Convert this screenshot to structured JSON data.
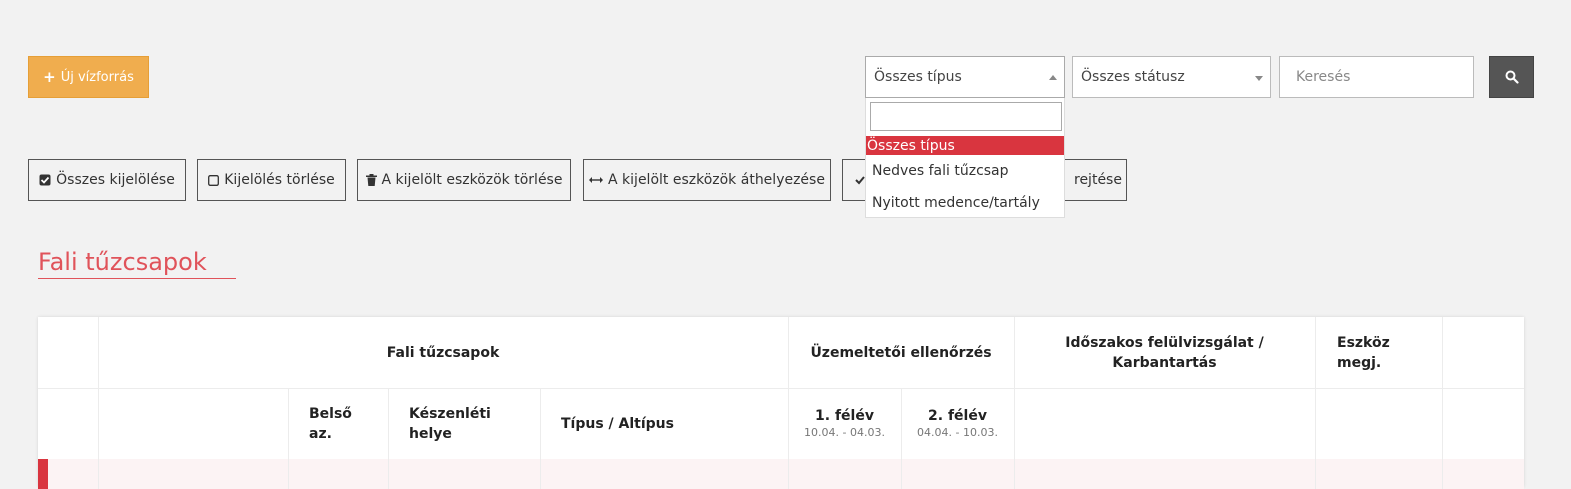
{
  "toolbar": {
    "new_label": "Új vízforrás",
    "type_filter": "Összes típus",
    "status_filter": "Összes státusz",
    "search_placeholder": "Keresés"
  },
  "type_dropdown": {
    "options": [
      "Összes típus",
      "Nedves fali tűzcsap",
      "Nyitott medence/tartály"
    ],
    "selected": "Összes típus"
  },
  "actions": {
    "select_all": "Összes kijelölése",
    "deselect": "Kijelölés törlése",
    "delete_selected": "A kijelölt eszközök törlése",
    "move_selected": "A kijelölt eszközök áthelyezése",
    "hide_partial": "rejtése"
  },
  "section": {
    "title": "Fali tűzcsapok"
  },
  "table": {
    "group_headers": {
      "main": "Fali tűzcsapok",
      "operator_check": "Üzemeltetői ellenőrzés",
      "periodic_line1": "Időszakos felülvizsgálat /",
      "periodic_line2": "Karbantartás",
      "device_note_line1": "Eszköz",
      "device_note_line2": "megj."
    },
    "columns": {
      "internal_id_line1": "Belső",
      "internal_id_line2": "az.",
      "standby_line1": "Készenléti",
      "standby_line2": "helye",
      "type_subtype": "Típus / Altípus",
      "half1": "1. félév",
      "half1_range": "10.04. - 04.03.",
      "half2": "2. félév",
      "half2_range": "04.04. - 10.03."
    }
  },
  "colors": {
    "accent_orange": "#f0ad4e",
    "accent_red": "#d9353f",
    "title_red": "#e0535a"
  }
}
